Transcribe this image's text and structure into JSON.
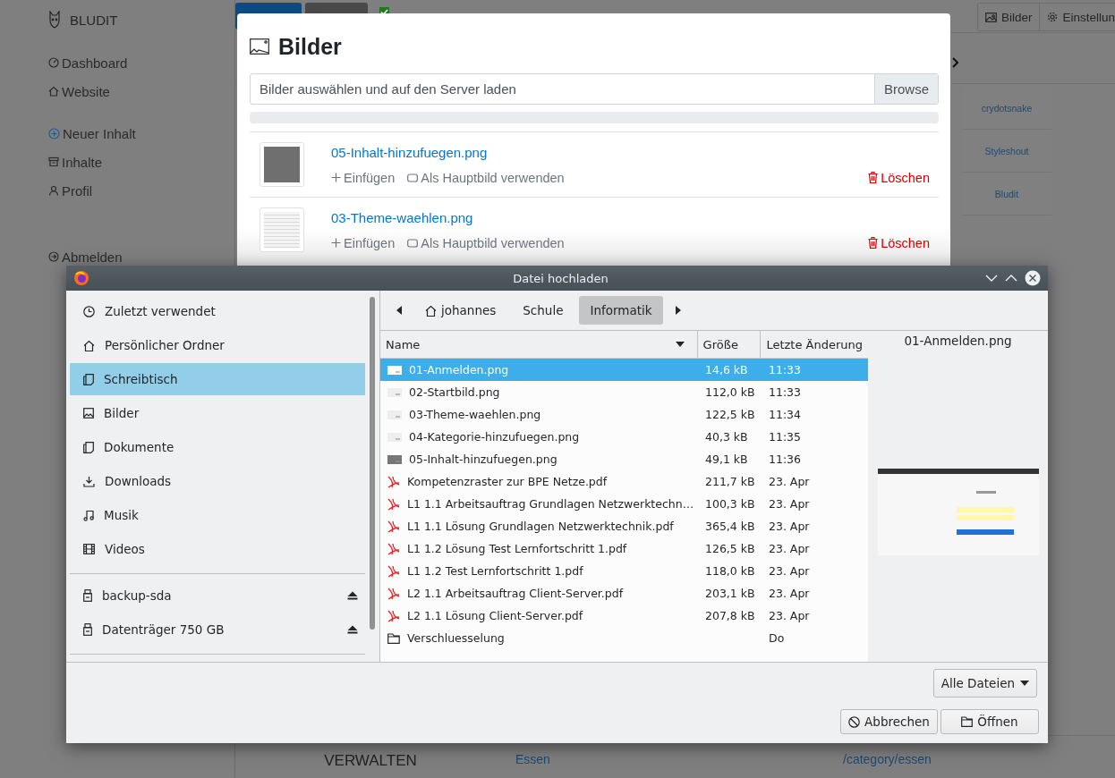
{
  "cms": {
    "brand": "BLUDIT",
    "nav_groups": [
      [
        {
          "label": "Dashboard"
        },
        {
          "label": "Website"
        }
      ],
      [
        {
          "label": "Neuer Inhalt"
        },
        {
          "label": "Inhalte"
        },
        {
          "label": "Profil"
        }
      ],
      [
        {
          "label": "Abmelden"
        }
      ]
    ],
    "publish_checkbox": {
      "checked": true
    },
    "toolbar": [
      {
        "label": "Bilder"
      },
      {
        "label": "Einstellun"
      }
    ],
    "authors": [
      "crydotsnake",
      "Styleshout",
      "Bludit"
    ],
    "bottom_row": {
      "section": "VERWALTEN",
      "category": "Essen",
      "url": "/category/essen"
    }
  },
  "images_modal": {
    "title": "Bilder",
    "upload": {
      "placeholder": "Bilder auswählen und auf den Server laden",
      "button": "Browse"
    },
    "progress": {
      "level": 0
    },
    "images": [
      {
        "name": "05-Inhalt-hinzufuegen.png",
        "insert": "Einfügen",
        "cover": "Als Hauptbild verwenden",
        "delete": "Löschen"
      },
      {
        "name": "03-Theme-waehlen.png",
        "insert": "Einfügen",
        "cover": "Als Hauptbild verwenden",
        "delete": "Löschen"
      }
    ]
  },
  "file_dialog": {
    "title": "Datei hochladen",
    "places": [
      {
        "label": "Zuletzt verwendet",
        "selected": false
      },
      {
        "label": "Persönlicher Ordner",
        "selected": false
      },
      {
        "label": "Schreibtisch",
        "selected": true
      },
      {
        "label": "Bilder",
        "selected": false
      },
      {
        "label": "Dokumente",
        "selected": false
      },
      {
        "label": "Downloads",
        "selected": false
      },
      {
        "label": "Musik",
        "selected": false
      },
      {
        "label": "Videos",
        "selected": false
      }
    ],
    "devices": [
      {
        "label": "backup-sda"
      },
      {
        "label": "Datenträger 750 GB"
      }
    ],
    "path": [
      {
        "label": "johannes",
        "selected": false
      },
      {
        "label": "Schule",
        "selected": false
      },
      {
        "label": "Informatik",
        "selected": true
      }
    ],
    "columns": [
      "Name",
      "Größe",
      "Letzte Änderung"
    ],
    "files": [
      {
        "kind": "image",
        "name": "01-Anmelden.png",
        "size": "14,6 kB",
        "modified": "11:33",
        "selected": true
      },
      {
        "kind": "image",
        "name": "02-Startbild.png",
        "size": "112,0 kB",
        "modified": "11:33",
        "selected": false
      },
      {
        "kind": "image",
        "name": "03-Theme-waehlen.png",
        "size": "122,5 kB",
        "modified": "11:34",
        "selected": false
      },
      {
        "kind": "image",
        "name": "04-Kategorie-hinzufuegen.png",
        "size": "40,3 kB",
        "modified": "11:35",
        "selected": false
      },
      {
        "kind": "image",
        "name": "05-Inhalt-hinzufuegen.png",
        "size": "49,1 kB",
        "modified": "11:36",
        "selected": false
      },
      {
        "kind": "pdf",
        "name": "Kompetenzraster zur BPE Netze.pdf",
        "size": "211,7 kB",
        "modified": "23. Apr",
        "selected": false
      },
      {
        "kind": "pdf",
        "name": "L1 1.1 Arbeitsauftrag Grundlagen Netzwerktechn…",
        "size": "100,3 kB",
        "modified": "23. Apr",
        "selected": false
      },
      {
        "kind": "pdf",
        "name": "L1 1.1 Lösung Grundlagen Netzwerktechnik.pdf",
        "size": "365,4 kB",
        "modified": "23. Apr",
        "selected": false
      },
      {
        "kind": "pdf",
        "name": "L1 1.2 Lösung Test Lernfortschritt 1.pdf",
        "size": "126,5 kB",
        "modified": "23. Apr",
        "selected": false
      },
      {
        "kind": "pdf",
        "name": "L1 1.2 Test Lernfortschritt 1.pdf",
        "size": "118,0 kB",
        "modified": "23. Apr",
        "selected": false
      },
      {
        "kind": "pdf",
        "name": "L2 1.1 Arbeitsauftrag Client-Server.pdf",
        "size": "203,1 kB",
        "modified": "23. Apr",
        "selected": false
      },
      {
        "kind": "pdf",
        "name": "L2 1.1 Lösung Client-Server.pdf",
        "size": "207,8 kB",
        "modified": "23. Apr",
        "selected": false
      },
      {
        "kind": "folder",
        "name": "Verschluesselung",
        "modified": "Do",
        "selected": false
      }
    ],
    "preview": {
      "name": "01-Anmelden.png"
    },
    "filter": "Alle Dateien",
    "buttons": {
      "cancel": "Abbrechen",
      "open": "Öffnen"
    }
  }
}
